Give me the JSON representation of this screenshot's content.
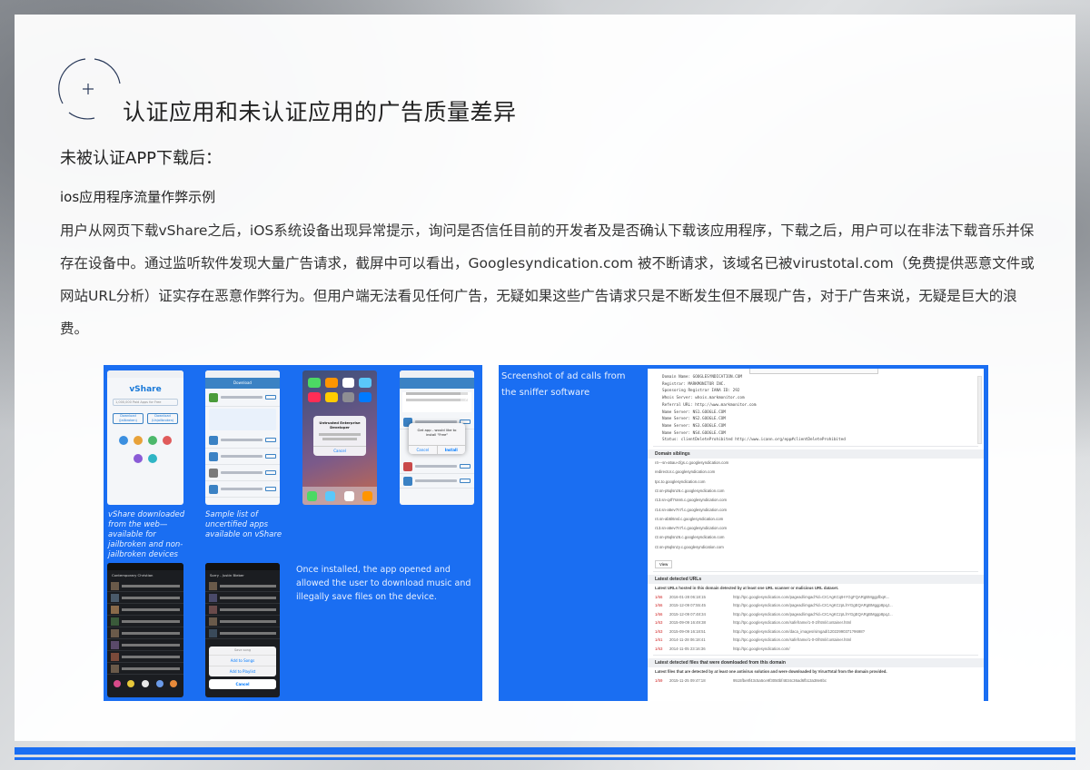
{
  "page": {
    "title": "认证应用和未认证应用的广告质量差异",
    "subtitle": "未被认证APP下载后：",
    "section_heading": "ios应用程序流量作弊示例",
    "paragraph": "用户从网页下载vShare之后，iOS系统设备出现异常提示，询问是否信任目前的开发者及是否确认下载该应用程序，下载之后，用户可以在非法下载音乐并保存在设备中。通过监听软件发现大量广告请求，截屏中可以看出，Googlesyndication.com 被不断请求，该域名已被virustotal.com（免费提供恶意文件或网站URL分析）证实存在恶意作弊行为。但用户端无法看见任何广告，无疑如果这些广告请求只是不断发生但不展现广告，对于广告来说，无疑是巨大的浪费。"
  },
  "colors": {
    "accent": "#1a6ef2",
    "title_text": "#222222",
    "body_text": "#333333"
  },
  "left_panel": {
    "caption_vshare": "vShare downloaded from the web—available for jailbroken and non-jailbroken devices",
    "caption_sample": "Sample list of uncertified apps available on vShare",
    "caption_installed": "Once installed, the app opened and allowed the user to download music and illegally save files on the device.",
    "phone1": {
      "title": "vShare",
      "search_placeholder": "1,000,000 Paid Apps for Free",
      "btn_jailbroken": "Download (Jailbroken)",
      "btn_unjailbroken": "Download (Unjailbroken)"
    },
    "phone2": {
      "header": "Download"
    },
    "phone3": {
      "dialog_title": "Untrusted Enterprise Developer",
      "dialog_button": "Cancel"
    },
    "phone4": {
      "dialog_text": "Get app - would like to install \"Free\"",
      "btn_cancel": "Cancel",
      "btn_install": "Install"
    },
    "phone5": {
      "header": "Contemporary Christian"
    },
    "phone6": {
      "header": "Sorry - Justin Bieber",
      "sheet_title": "Save song",
      "sheet_opt1": "Add to Songs",
      "sheet_opt2": "Add to Playlist",
      "sheet_cancel": "Cancel"
    }
  },
  "right_panel": {
    "caption": "Screenshot of ad calls from the sniffer software",
    "whois": [
      "Domain Name: GOOGLESYNDICATION.COM",
      "Registrar: MARKMONITOR INC.",
      "Sponsoring Registrar IANA ID: 292",
      "Whois Server: whois.markmonitor.com",
      "Referral URL: http://www.markmonitor.com",
      "Name Server: NS1.GOOGLE.COM",
      "Name Server: NS2.GOOGLE.COM",
      "Name Server: NS3.GOOGLE.COM",
      "Name Server: NS4.GOOGLE.COM",
      "Status: clientDeleteProhibited http://www.icann.org/epp#clientDeleteProhibited"
    ],
    "siblings_heading": "Domain siblings",
    "siblings": [
      "r4---sn-a5au-cfgs.c.googlesyndication.com",
      "redirector.c.googlesyndication.com",
      "tpc.to.googlesyndication.com",
      "r2.sn-p5qlsnz6.c.googlesyndication.com",
      "r13.sn-q4f7sns6.c.googlesyndication.com",
      "r14.sn-a5ev7n7l.c.googlesyndication.com",
      "r4.sn-ab5l6nsl.c.googlesyndication.com",
      "r13.sn-a5ev7n7l.c.googlesyndication.com",
      "r2.sn-p5qlsnz6.c.googlesyndication.com",
      "r2.sn-p5qlsnzy.c.googlesyndication.com"
    ],
    "view_label": "View",
    "urls_heading": "Latest detected URLs",
    "urls_note": "Latest URLs hosted in this domain detected by at least one URL scanner or malicious URL dataset.",
    "urls": [
      {
        "ratio": "1/66",
        "date": "2016-01-28 06:18:15",
        "url": "http://tpc.googlesyndication.com/pagead/imgad?id=CICAgKCqtHYGgFQARgBMggpfbqK..."
      },
      {
        "ratio": "1/66",
        "date": "2015-12-09 07:55:45",
        "url": "http://tpc.googlesyndication.com/pagead/imgad?id=CICAgKCzpLhYGgEQARgBMggp8pqJ..."
      },
      {
        "ratio": "1/66",
        "date": "2015-12-09 07:48:34",
        "url": "http://tpc.googlesyndication.com/pagead/imgad?id=CICAgKCzpLhYGgEQARgBMggp8pqJ..."
      },
      {
        "ratio": "1/63",
        "date": "2015-09-09 16:49:38",
        "url": "http://tpc.googlesyndication.com/safeframe/1-0-2/html/container.html"
      },
      {
        "ratio": "1/63",
        "date": "2015-09-09 16:18:51",
        "url": "http://tpc.googlesyndication.com/daca_images/simgad/12022990371?9698?"
      },
      {
        "ratio": "1/61",
        "date": "2014-11-28 06:18:41",
        "url": "http://tpc.googlesyndication.com/safeframe/1-0-0/html/container.html"
      },
      {
        "ratio": "1/63",
        "date": "2014-11-05 23:16:36",
        "url": "http://tpc.googlesyndication.com/"
      }
    ],
    "files_heading": "Latest detected files that were downloaded from this domain",
    "files_note": "Latest files that are detected by at least one antivirus solution and were downloaded by VirusTotal from the domain provided.",
    "files": [
      {
        "ratio": "1/59",
        "date": "2015-11-25 09:47:18",
        "hash": "9515fbe8f43c5a5ce9f3050bf4834c36ad6fb13a38e8bc"
      }
    ]
  }
}
